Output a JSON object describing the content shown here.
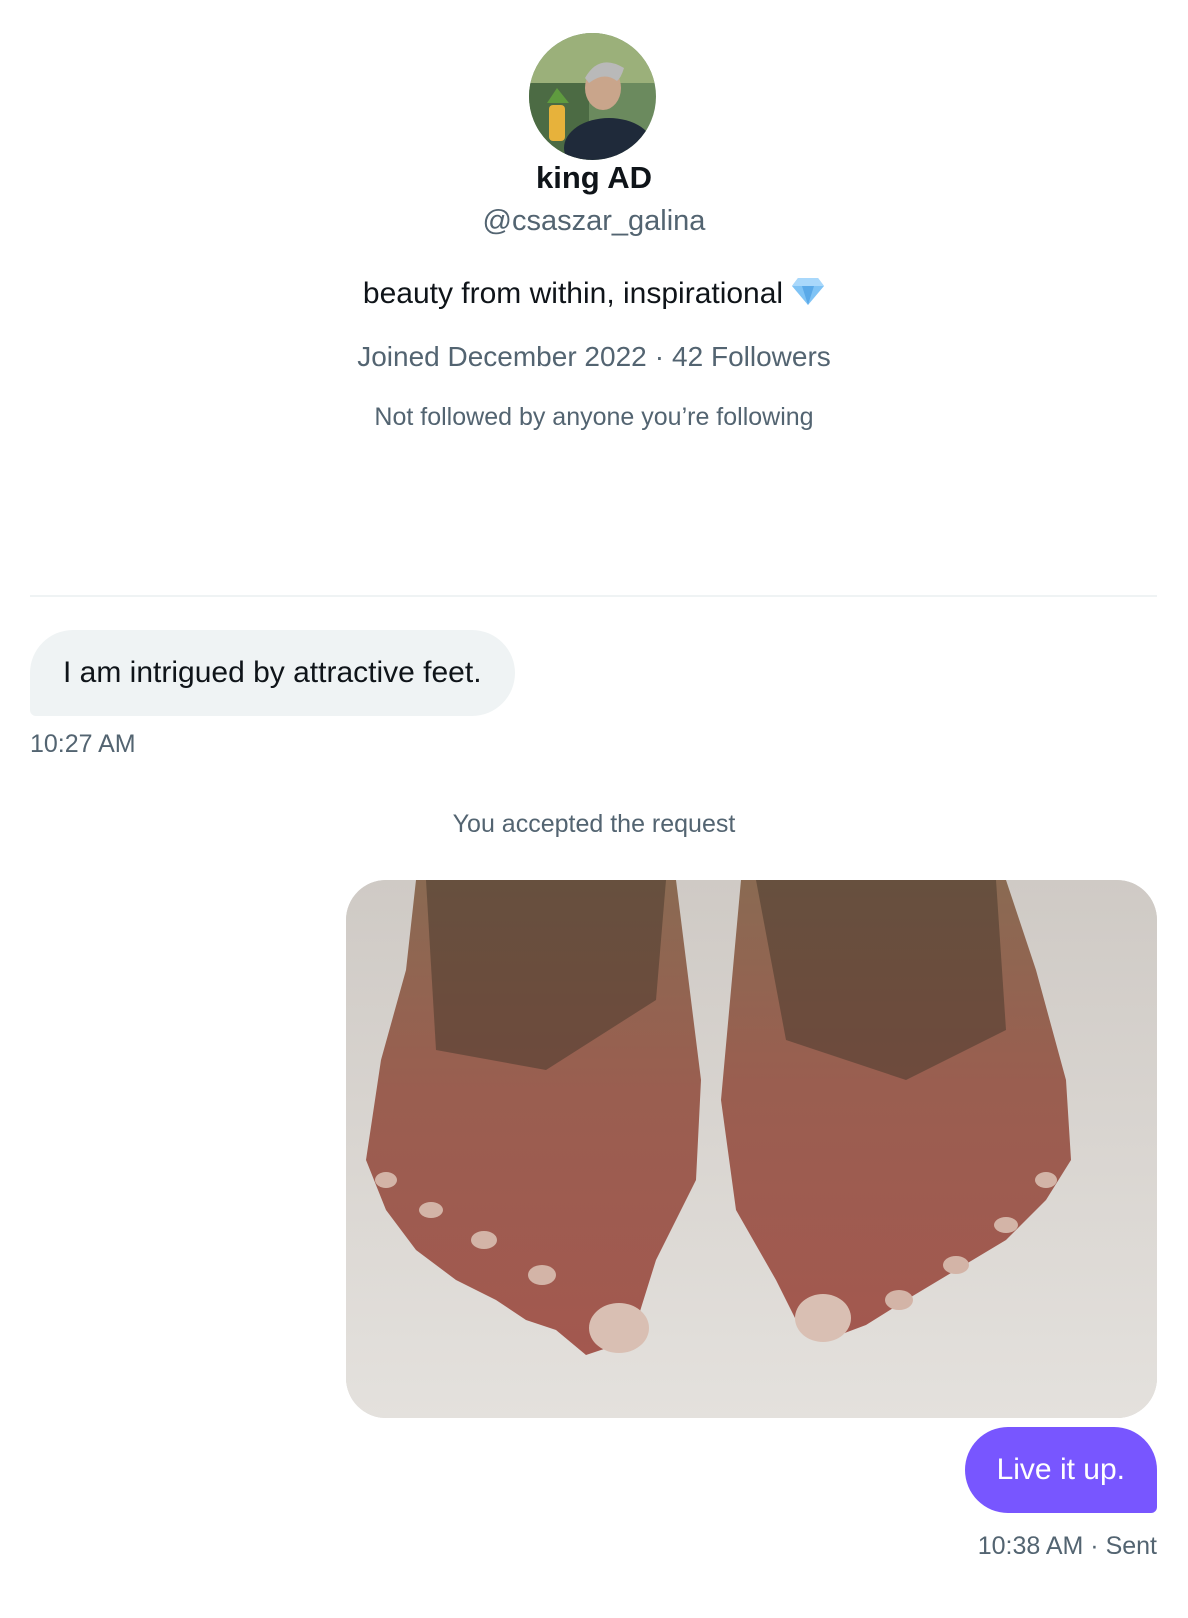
{
  "profile": {
    "display_name": "king AD",
    "handle": "@csaszar_galina",
    "bio": "beauty from within, inspirational",
    "bio_emoji_icon": "gem-icon",
    "joined": "Joined December 2022",
    "separator": "·",
    "followers": "42 Followers",
    "not_followed_note": "Not followed by anyone you’re following"
  },
  "conversation": {
    "incoming": {
      "text": "I am intrigued by attractive feet.",
      "time": "10:27 AM"
    },
    "system_message": "You accepted the request",
    "outgoing": {
      "image_icon": "photo-feet",
      "text": "Live it up.",
      "time": "10:38 AM",
      "separator": "·",
      "status": "Sent"
    }
  },
  "colors": {
    "accent_purple": "#7856ff",
    "secondary_text": "#536471",
    "incoming_bubble": "#eff3f4"
  }
}
